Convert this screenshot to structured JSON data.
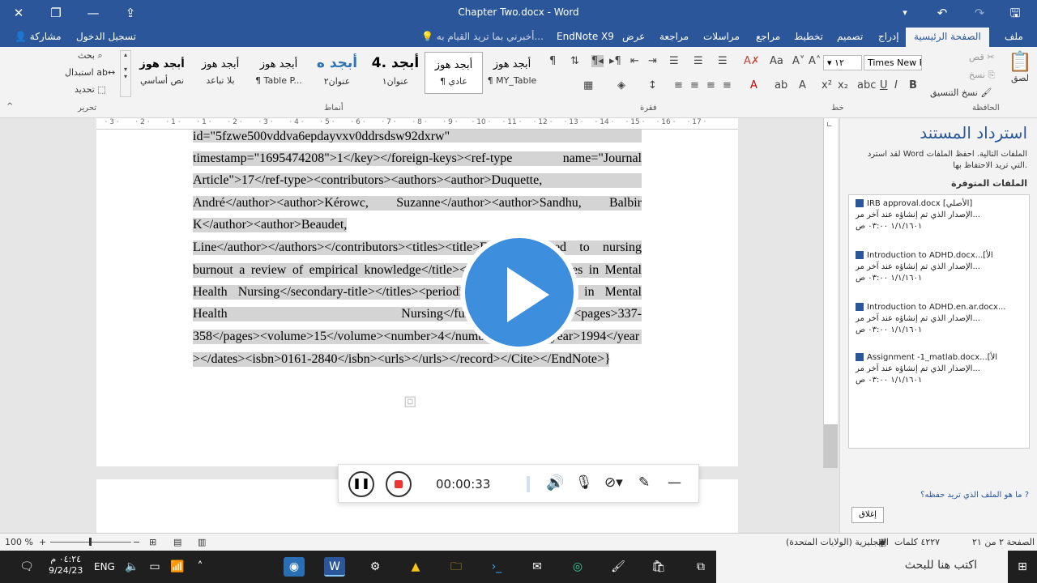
{
  "window": {
    "title": "Chapter Two.docx - Word"
  },
  "tabs": [
    {
      "label": "ملف",
      "active": false
    },
    {
      "label": "الصفحة الرئيسية",
      "active": true
    },
    {
      "label": "إدراج",
      "active": false
    },
    {
      "label": "تصميم",
      "active": false
    },
    {
      "label": "تخطيط",
      "active": false
    },
    {
      "label": "مراجع",
      "active": false
    },
    {
      "label": "مراسلات",
      "active": false
    },
    {
      "label": "مراجعة",
      "active": false
    },
    {
      "label": "عرض",
      "active": false
    },
    {
      "label": "EndNote X9",
      "active": false
    }
  ],
  "tellme": "أخبرني بما تريد القيام به...",
  "signin": "تسجيل الدخول",
  "share": "مشاركة",
  "ribbon": {
    "clipboard": {
      "label": "الحافظة",
      "paste": "لصق",
      "cut": "قص",
      "copy": "نسخ",
      "format_painter": "نسخ التنسيق"
    },
    "font": {
      "label": "خط",
      "name": "Times New R",
      "size": "١٢"
    },
    "paragraph": {
      "label": "فقرة"
    },
    "styles": {
      "label": "أنماط",
      "items": [
        {
          "preview": "أبجد هوز",
          "name": "¶ MY_Table"
        },
        {
          "preview": "أبجد هوز",
          "name": "¶ عادي"
        },
        {
          "preview": "4. أبجد",
          "name": "عنوان١"
        },
        {
          "preview": "أبجد ه",
          "name": "عنوان٢"
        },
        {
          "preview": "أبجد هوز",
          "name": "¶ Table P..."
        },
        {
          "preview": "أبجد هوز",
          "name": "بلا تباعد"
        },
        {
          "preview": "أبجد هوز",
          "name": "نص أساسي"
        }
      ]
    },
    "editing": {
      "label": "تحرير",
      "find": "بحث",
      "replace": "استبدال",
      "select": "تحديد"
    }
  },
  "ruler": [
    "3",
    "2",
    "1",
    "1",
    "2",
    "3",
    "4",
    "5",
    "6",
    "7",
    "8",
    "9",
    "10",
    "11",
    "12",
    "13",
    "14",
    "15",
    "16",
    "17"
  ],
  "document": {
    "lines": [
      "id=\"5fzwe500vddva6epdayvxv0ddrsdsw92dxrw\"",
      "timestamp=\"1695474208\">1</key></foreign-keys><ref-type name=\"Journal",
      "Article\">17</ref-type><contributors><authors><author>Duquette,",
      "André</author><author>Kérowc, Suzanne</author><author>Sandhu, Balbir",
      "K</author><author>Beaudet,",
      "Line</author></authors></contributors><titles><title>Factors related to nursing",
      "burnout a review of empirical knowledge</title><secondary-title>Issues in Mental",
      "Health Nursing</secondary-title></titles><periodical><full-title>Issues in Mental",
      "Health Nursing</full-title></periodical><pages>337-",
      "358</pages><volume>15</volume><number>4</number><dates><year>1994</year",
      "></dates><isbn>0161-2840</isbn><urls></urls></record></Cite></EndNote>}"
    ]
  },
  "recovery": {
    "title": "استرداد المستند",
    "description": "لقد استرد Word الملفات التالية. احفظ الملفات التي تريد الاحتفاظ بها.",
    "available": "الملفات المتوفرة",
    "files": [
      {
        "name": "IRB approval.docx [الأصلي]",
        "detail": "الإصدار الذي تم إنشاؤه عند آخر مر...",
        "date": "١/١/١٦٠١ ٠٣:٠٠ ص"
      },
      {
        "name": "Introduction to ADHD.docx...[الأ",
        "detail": "الإصدار الذي تم إنشاؤه عند آخر مر...",
        "date": "١/١/١٦٠١ ٠٣:٠٠ ص"
      },
      {
        "name": "Introduction to ADHD.en.ar.docx...",
        "detail": "الإصدار الذي تم إنشاؤه عند آخر مر...",
        "date": "١/١/١٦٠١ ٠٣:٠٠ ص"
      },
      {
        "name": "Assignment -1_matlab.docx...[الأ",
        "detail": "الإصدار الذي تم إنشاؤه عند آخر مر...",
        "date": "١/١/١٦٠١ ٠٣:٠٠ ص"
      }
    ],
    "question": "ما هو الملف الذي تريد حفظه؟",
    "close": "إغلاق"
  },
  "recorder": {
    "time": "00:00:33"
  },
  "status": {
    "page": "الصفحة ٢ من ٢١",
    "words": "٤٢٢٧ كلمات",
    "language": "الإنجليزية (الولايات المتحدة)",
    "zoom": "100 %"
  },
  "taskbar": {
    "search": "اكتب هنا للبحث",
    "lang": "ENG",
    "time": "٠٤:٢٤ م",
    "date": "9/24/23"
  }
}
